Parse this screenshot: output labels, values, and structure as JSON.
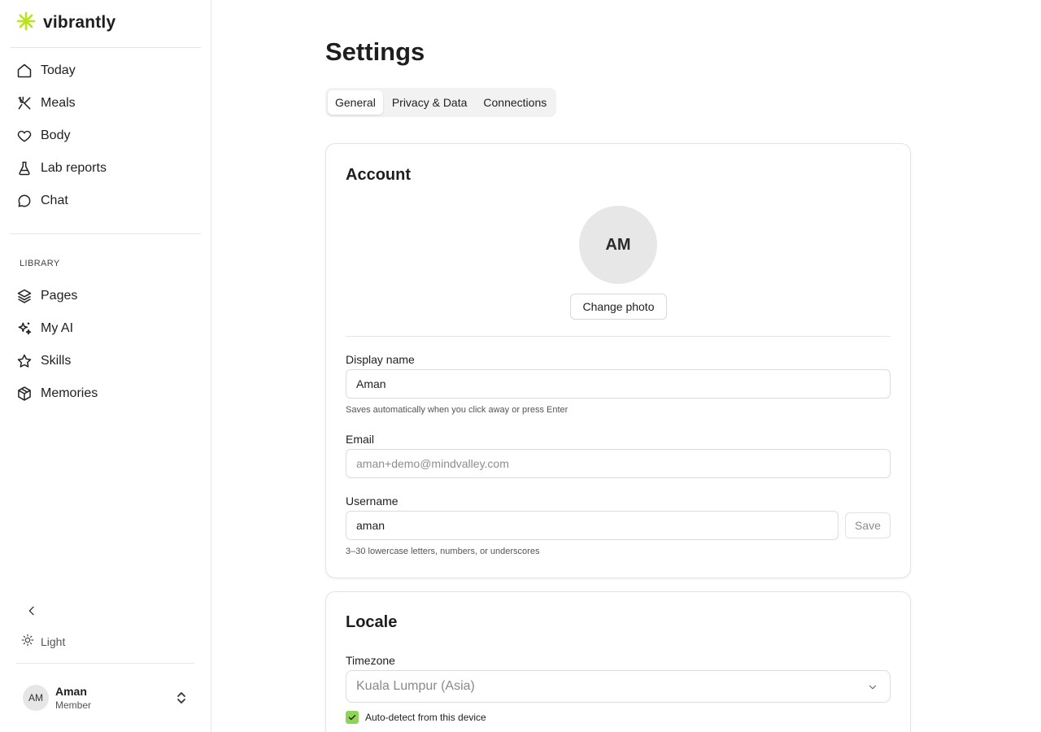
{
  "brand": {
    "name": "vibrantly",
    "accent_color": "#b9e31a",
    "logo_icon": "asterisk-logo-icon"
  },
  "nav": {
    "main": [
      {
        "id": "today",
        "label": "Today",
        "icon": "home-icon"
      },
      {
        "id": "meals",
        "label": "Meals",
        "icon": "utensils-crossed-icon"
      },
      {
        "id": "body",
        "label": "Body",
        "icon": "heart-icon"
      },
      {
        "id": "lab-reports",
        "label": "Lab reports",
        "icon": "flask-icon"
      },
      {
        "id": "chat",
        "label": "Chat",
        "icon": "chat-bubble-icon"
      }
    ],
    "library_label": "LIBRARY",
    "library": [
      {
        "id": "pages",
        "label": "Pages",
        "icon": "layers-icon"
      },
      {
        "id": "my-ai",
        "label": "My AI",
        "icon": "sparkles-icon"
      },
      {
        "id": "skills",
        "label": "Skills",
        "icon": "star-icon"
      },
      {
        "id": "memories",
        "label": "Memories",
        "icon": "cube-icon"
      }
    ]
  },
  "sidebar_footer": {
    "collapse_icon": "chevron-left-icon",
    "theme_label": "Light",
    "theme_icon": "sun-icon",
    "user": {
      "initials": "AM",
      "name": "Aman",
      "role": "Member"
    }
  },
  "page": {
    "title": "Settings",
    "tabs": [
      {
        "label": "General",
        "active": true
      },
      {
        "label": "Privacy & Data",
        "active": false
      },
      {
        "label": "Connections",
        "active": false
      }
    ]
  },
  "account": {
    "title": "Account",
    "avatar_initials": "AM",
    "change_photo_label": "Change photo",
    "display_name": {
      "label": "Display name",
      "value": "Aman",
      "hint": "Saves automatically when you click away or press Enter"
    },
    "email": {
      "label": "Email",
      "value": "aman+demo@mindvalley.com"
    },
    "username": {
      "label": "Username",
      "value": "aman",
      "save_label": "Save",
      "hint": "3–30 lowercase letters, numbers, or underscores"
    }
  },
  "locale": {
    "title": "Locale",
    "timezone": {
      "label": "Timezone",
      "value": "Kuala Lumpur (Asia)"
    },
    "auto_detect": {
      "label": "Auto-detect from this device",
      "checked": true,
      "color": "#8fd45a"
    }
  }
}
